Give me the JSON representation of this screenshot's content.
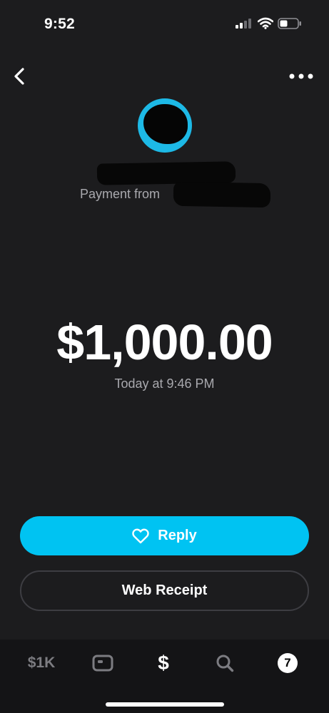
{
  "status_bar": {
    "time": "9:52",
    "icons": [
      "cellular-signal-icon",
      "wifi-icon",
      "battery-icon"
    ]
  },
  "nav": {
    "back_icon": "chevron-left-icon",
    "more_icon": "more-horizontal-icon"
  },
  "payment": {
    "from_prefix": "Payment from",
    "amount": "$1,000.00",
    "timestamp": "Today at 9:46 PM"
  },
  "actions": {
    "reply_label": "Reply",
    "reply_icon": "heart-outline-icon",
    "web_receipt_label": "Web Receipt"
  },
  "tab_bar": {
    "balance_label": "$1K",
    "money_label": "$",
    "activity_badge": "7"
  },
  "colors": {
    "background": "#1c1c1e",
    "accent": "#00c3f2",
    "avatar": "#1db9e6",
    "muted_text": "#a9a9ae",
    "tab_bar": "#141416"
  }
}
